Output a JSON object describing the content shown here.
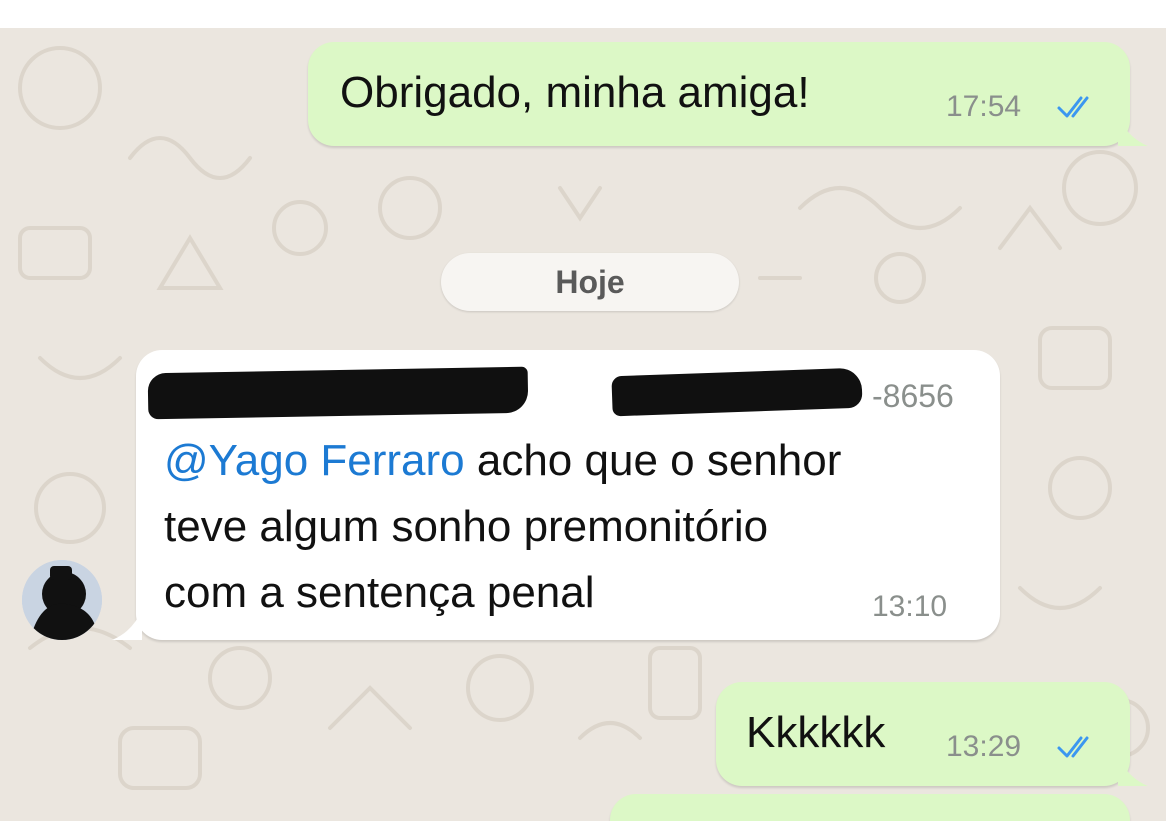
{
  "chat": {
    "messages": [
      {
        "direction": "outgoing",
        "text": "Obrigado, minha amiga!",
        "time": "17:54",
        "status": "read"
      },
      {
        "direction": "incoming",
        "sender_phone_suffix": "-8656",
        "mention": "@Yago Ferraro",
        "text_line1": " acho que o senhor",
        "text_line2": "teve algum sonho premonitório",
        "text_line3": "com a sentença penal",
        "time": "13:10"
      },
      {
        "direction": "outgoing",
        "text": "Kkkkkk",
        "time": "13:29",
        "status": "read"
      }
    ],
    "date_separator": "Hoje"
  },
  "colors": {
    "outgoing_bubble": "#dcf8c6",
    "incoming_bubble": "#ffffff",
    "chat_background": "#ebe6df",
    "mention": "#1c7ad3",
    "read_ticks": "#3b97f0"
  },
  "icons": {
    "read_receipt": "double-check-icon",
    "avatar": "contact-avatar"
  }
}
